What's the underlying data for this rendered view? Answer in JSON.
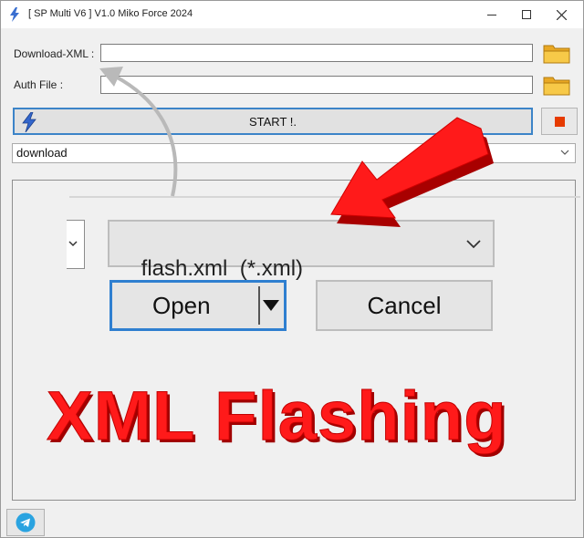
{
  "window": {
    "title": "[ SP Multi V6 ] V1.0 Miko Force 2024"
  },
  "form": {
    "download_xml_label": "Download-XML :",
    "download_xml_value": "",
    "auth_file_label": "Auth File :",
    "auth_file_value": ""
  },
  "toolbar": {
    "start_label": "START !."
  },
  "mode": {
    "selected": "download"
  },
  "dialog": {
    "file_type": "flash.xml  (*.xml)",
    "open_label": "Open",
    "cancel_label": "Cancel"
  },
  "overlay": {
    "headline": "XML Flashing"
  },
  "icons": {
    "app": "lightning-icon",
    "browse": "folder-icon",
    "stop": "stop-icon",
    "telegram": "telegram-icon"
  },
  "colors": {
    "accent": "#3c84c8",
    "stop": "#e63b00",
    "headline": "#ff1a1a",
    "folder": "#f2b632"
  }
}
